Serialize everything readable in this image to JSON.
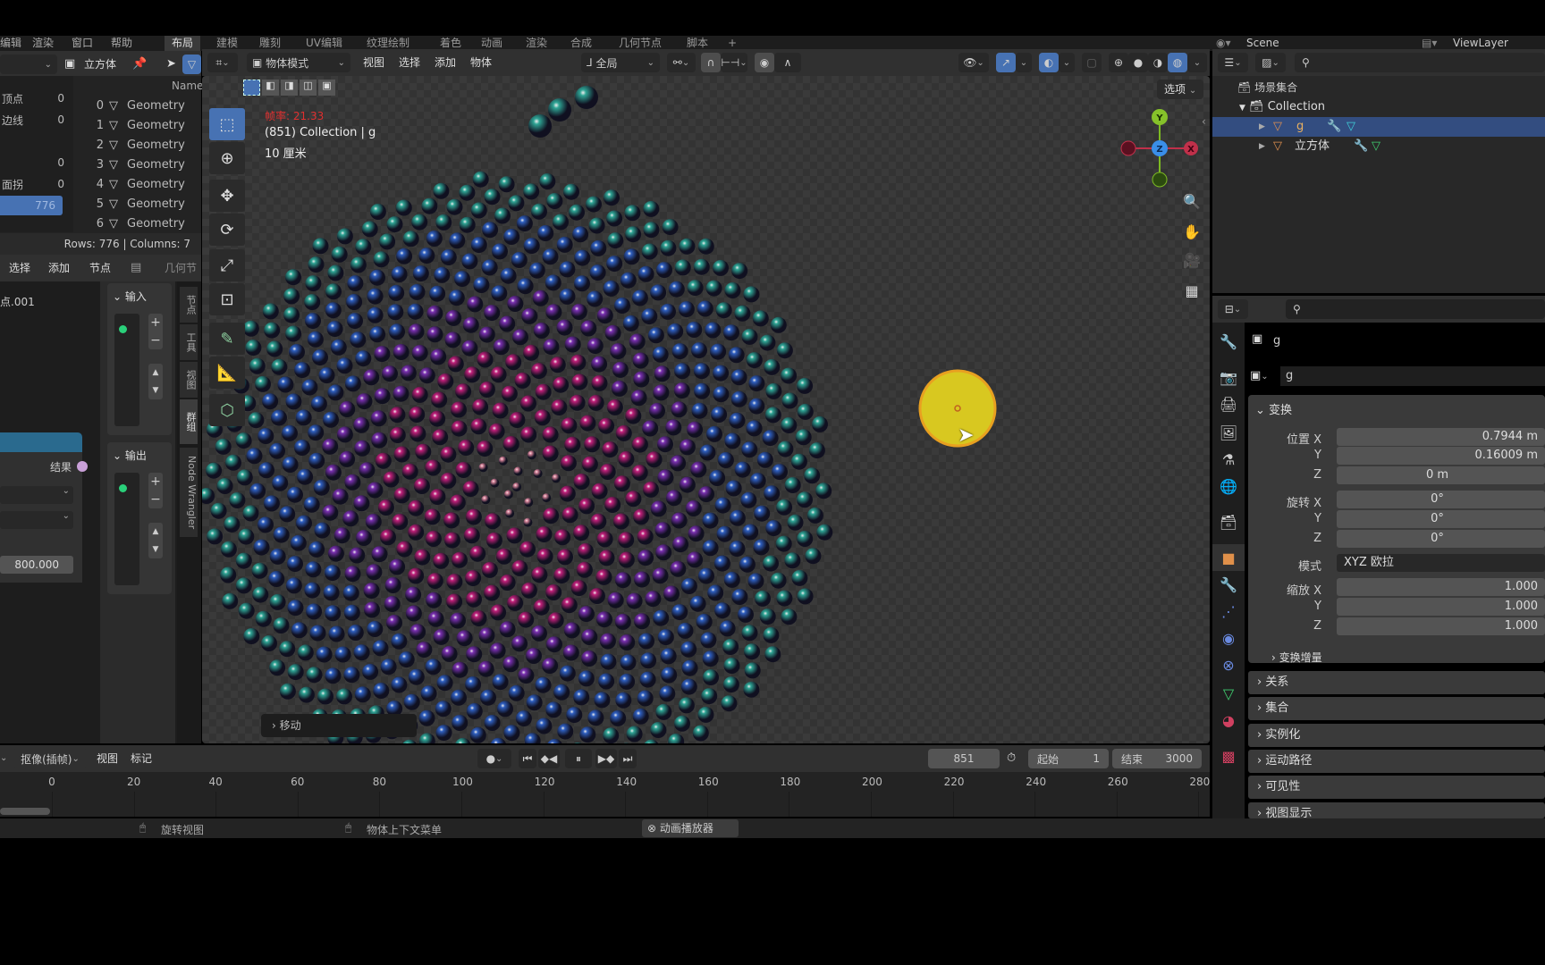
{
  "topbar": {
    "menus": [
      "编辑",
      "渲染",
      "窗口",
      "帮助"
    ],
    "workspaces": [
      "布局",
      "建模",
      "雕刻",
      "UV编辑",
      "纹理绘制",
      "着色",
      "动画",
      "渲染",
      "合成",
      "几何节点",
      "脚本",
      "+"
    ],
    "active_workspace": "布局",
    "scene": "Scene",
    "view_layer": "ViewLayer"
  },
  "spreadsheet": {
    "header_object": "立方体",
    "domains": [
      {
        "label": "顶点",
        "count": "0"
      },
      {
        "label": "边线",
        "count": "0"
      },
      {
        "label": "",
        "count": ""
      },
      {
        "label": "",
        "count": "0"
      },
      {
        "label": "面拐",
        "count": "0"
      },
      {
        "label": "",
        "count": "776",
        "active": true
      }
    ],
    "column_header": "Name",
    "rows": [
      {
        "index": "0",
        "name": "Geometry"
      },
      {
        "index": "1",
        "name": "Geometry"
      },
      {
        "index": "2",
        "name": "Geometry"
      },
      {
        "index": "3",
        "name": "Geometry"
      },
      {
        "index": "4",
        "name": "Geometry"
      },
      {
        "index": "5",
        "name": "Geometry"
      },
      {
        "index": "6",
        "name": "Geometry"
      }
    ],
    "footer": "Rows: 776   |   Columns: 7"
  },
  "node_editor": {
    "menus": [
      "选择",
      "添加",
      "节点"
    ],
    "tree_name": "几何节",
    "node_label": "点.001",
    "output_socket": "结果",
    "value_field": "800.000",
    "side_tabs": [
      "节点",
      "工具",
      "视图",
      "群组",
      "Node Wrangler"
    ],
    "input_panel": "输入",
    "output_panel": "输出"
  },
  "viewport": {
    "mode": "物体模式",
    "menus": [
      "视图",
      "选择",
      "添加",
      "物体"
    ],
    "transform_orientation": "全局",
    "options_label": "选项",
    "overlay_fps": "帧率: 21.33",
    "overlay_object": "(851) Collection | g",
    "overlay_scale": "10 厘米",
    "last_op": "移动",
    "gizmo_axes": {
      "x": "X",
      "y": "Y",
      "z": "Z"
    },
    "tools": [
      "select-box",
      "cursor",
      "move",
      "rotate",
      "scale",
      "transform",
      "annotate",
      "measure",
      "add-cube"
    ],
    "colors": {
      "teal": "#2fa595",
      "blue": "#2f5fc0",
      "purple": "#7a30b0",
      "magenta": "#c0207a",
      "pink": "#e08aa0",
      "yellow": "#d8c820"
    }
  },
  "outliner": {
    "root": "场景集合",
    "collection": "Collection",
    "items": [
      {
        "name": "g",
        "selected": true
      },
      {
        "name": "立方体",
        "selected": false
      }
    ]
  },
  "properties": {
    "object_name": "g",
    "data_name": "g",
    "section_transform": "变换",
    "location": {
      "label": "位置 X",
      "x": "0.7944 m",
      "y": "0.16009 m",
      "z": "0 m"
    },
    "rotation": {
      "label": "旋转 X",
      "x": "0°",
      "y": "0°",
      "z": "0°"
    },
    "rotation_mode_label": "模式",
    "rotation_mode": "XYZ 欧拉",
    "scale": {
      "label": "缩放 X",
      "x": "1.000",
      "y": "1.000",
      "z": "1.000"
    },
    "axis_labels": [
      "Y",
      "Z"
    ],
    "subsections": [
      "变换增量",
      "关系",
      "集合",
      "实例化",
      "运动路径",
      "可见性",
      "视图显示"
    ]
  },
  "timeline": {
    "mode": "抠像(插帧)",
    "menus": [
      "视图",
      "标记"
    ],
    "current_frame": "851",
    "start_label": "起始",
    "start": "1",
    "end_label": "结束",
    "end": "3000",
    "ruler_ticks": [
      "0",
      "20",
      "40",
      "60",
      "80",
      "100",
      "120",
      "140",
      "160",
      "180",
      "200",
      "220",
      "240",
      "260",
      "280"
    ]
  },
  "statusbar": {
    "items": [
      "旋转视图",
      "物体上下文菜单",
      "动画播放器"
    ]
  }
}
